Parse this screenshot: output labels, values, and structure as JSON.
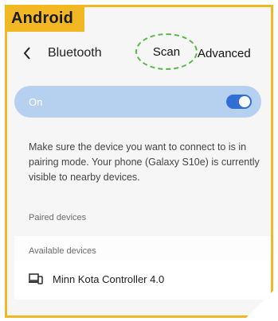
{
  "tag": "Android",
  "header": {
    "back_icon": "chevron-left-icon",
    "title": "Bluetooth",
    "scan_label": "Scan",
    "advanced_label": "Advanced"
  },
  "bluetooth_toggle": {
    "label": "On",
    "state": "on"
  },
  "info_text": "Make sure the device you want to connect to is in pairing mode. Your phone (Galaxy S10e) is currently visible to nearby devices.",
  "paired_section": {
    "label": "Paired devices"
  },
  "available_section": {
    "label": "Available devices",
    "devices": [
      {
        "icon": "laptop-phone-icon",
        "name": "Minn Kota Controller 4.0"
      }
    ]
  },
  "colors": {
    "accent": "#f2b823",
    "highlight": "#57b845",
    "toggle_bg": "#b6d1f0",
    "switch": "#2f6fd6"
  }
}
